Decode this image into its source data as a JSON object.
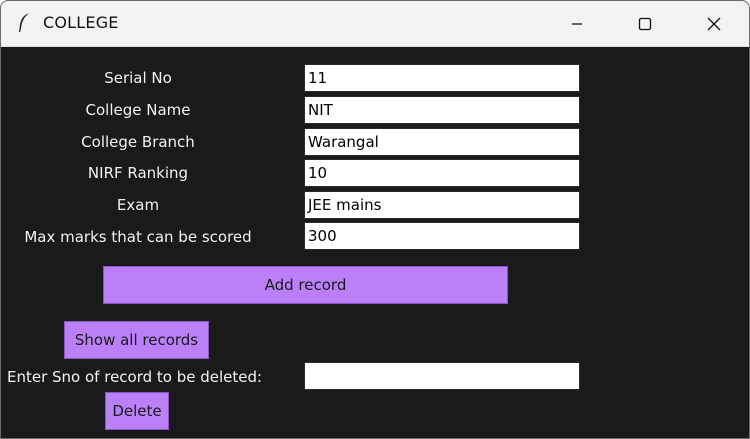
{
  "window": {
    "title": "COLLEGE",
    "icon": "feather-icon"
  },
  "controls": {
    "minimize_icon": "minimize-icon",
    "maximize_icon": "maximize-icon",
    "close_icon": "close-icon"
  },
  "form": {
    "serial_no": {
      "label": "Serial No",
      "value": "11"
    },
    "college_name": {
      "label": "College Name",
      "value": "NIT"
    },
    "college_branch": {
      "label": "College Branch",
      "value": "Warangal"
    },
    "nirf_ranking": {
      "label": "NIRF Ranking",
      "value": "10"
    },
    "exam": {
      "label": "Exam",
      "value": "JEE mains"
    },
    "max_marks": {
      "label": "Max marks that can be scored",
      "value": "300"
    }
  },
  "actions": {
    "add_record": "Add record",
    "show_all_records": "Show all records",
    "delete_prompt": "Enter Sno of record to be deleted:",
    "delete_value": "",
    "delete": "Delete"
  },
  "colors": {
    "background": "#1a1a1a",
    "titlebar": "#f3f3f3",
    "button": "#bb7ff7",
    "input": "#ffffff",
    "label_text": "#f2f2f2"
  }
}
